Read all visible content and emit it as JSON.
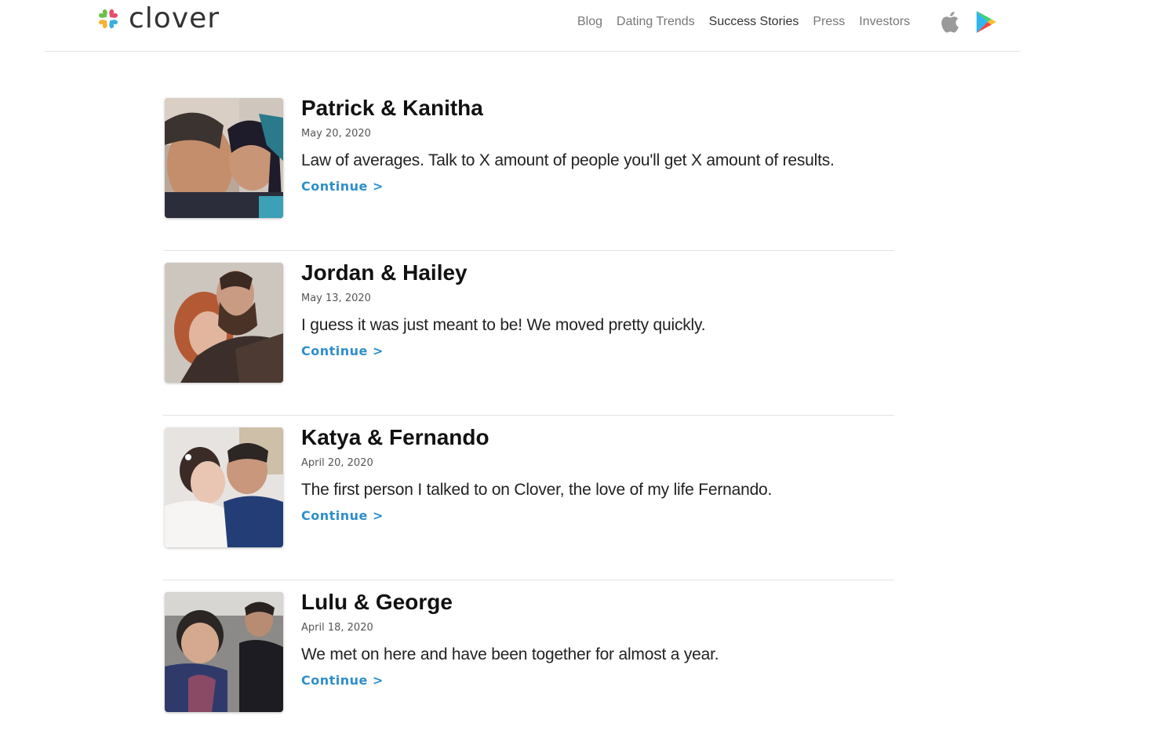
{
  "brand": {
    "name": "clover"
  },
  "nav": {
    "items": [
      {
        "label": "Blog"
      },
      {
        "label": "Dating Trends"
      },
      {
        "label": "Success Stories",
        "active": true
      },
      {
        "label": "Press"
      },
      {
        "label": "Investors"
      }
    ],
    "store_icons": [
      "apple-icon",
      "google-play-icon"
    ]
  },
  "stories": [
    {
      "title": "Patrick & Kanitha",
      "date": "May 20, 2020",
      "quote": "Law of averages. Talk to X amount of people you'll get X amount of results.",
      "link": "Continue >"
    },
    {
      "title": "Jordan & Hailey",
      "date": "May 13, 2020",
      "quote": "I guess it was just meant to be! We moved pretty quickly.",
      "link": "Continue >"
    },
    {
      "title": "Katya & Fernando",
      "date": "April 20, 2020",
      "quote": "The first person I talked to on Clover, the love of my life Fernando.",
      "link": "Continue >"
    },
    {
      "title": "Lulu & George",
      "date": "April 18, 2020",
      "quote": "We met on here and have been together for almost a year.",
      "link": "Continue >"
    }
  ],
  "colors": {
    "link": "#2f8ecb",
    "nav": "#777777",
    "nav_active": "#333333",
    "divider": "#e3e3e3"
  }
}
